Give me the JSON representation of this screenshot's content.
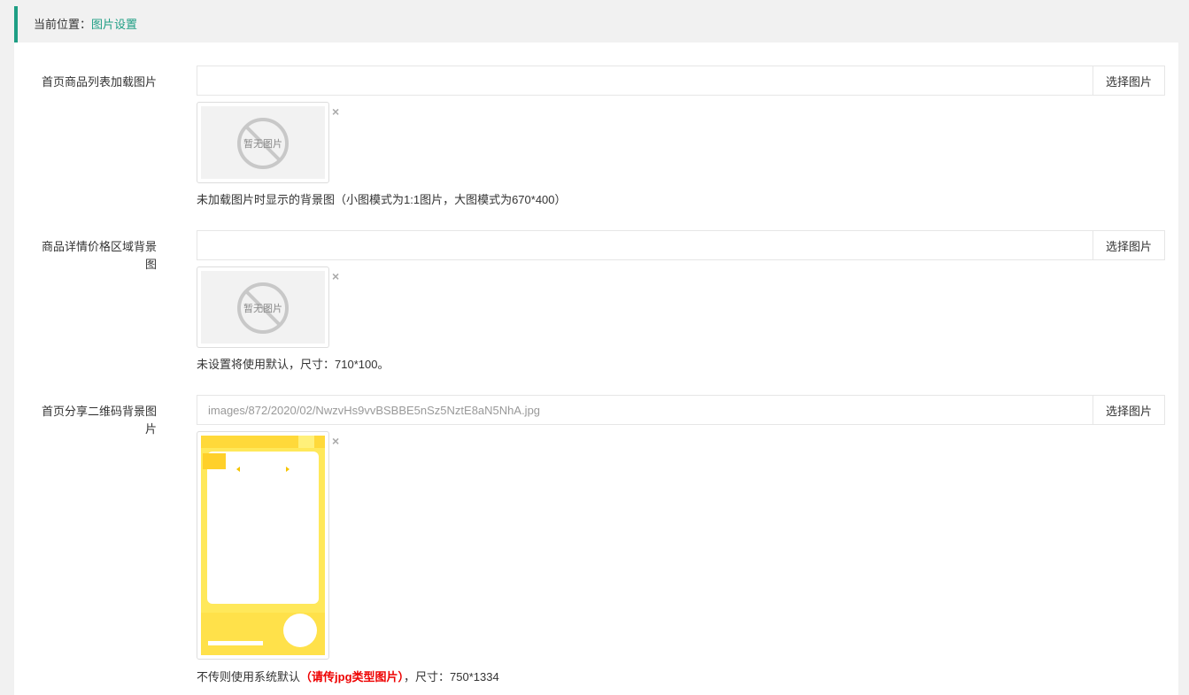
{
  "breadcrumb": {
    "prefix": "当前位置：",
    "current": "图片设置"
  },
  "rows": [
    {
      "label": "首页商品列表加载图片",
      "value": "",
      "button": "选择图片",
      "thumb_text": "暂无图片",
      "remove": "×",
      "help": "未加载图片时显示的背景图（小图模式为1:1图片，大图模式为670*400）"
    },
    {
      "label": "商品详情价格区域背景图",
      "value": "",
      "button": "选择图片",
      "thumb_text": "暂无图片",
      "remove": "×",
      "help": "未设置将使用默认，尺寸：710*100。"
    },
    {
      "label": "首页分享二维码背景图片",
      "value": "images/872/2020/02/NwzvHs9vvBSBBE5nSz5NztE8aN5NhA.jpg",
      "button": "选择图片",
      "remove": "×",
      "help_pre": "不传则使用系统默认",
      "help_warn": "（请传jpg类型图片）",
      "help_post": "，尺寸：750*1334"
    }
  ],
  "colors": {
    "accent": "#1e9e84",
    "warn": "#e00000",
    "poster": "#ffe85a"
  },
  "icons": {
    "remove": "close-icon",
    "placeholder": "no-image-icon"
  }
}
